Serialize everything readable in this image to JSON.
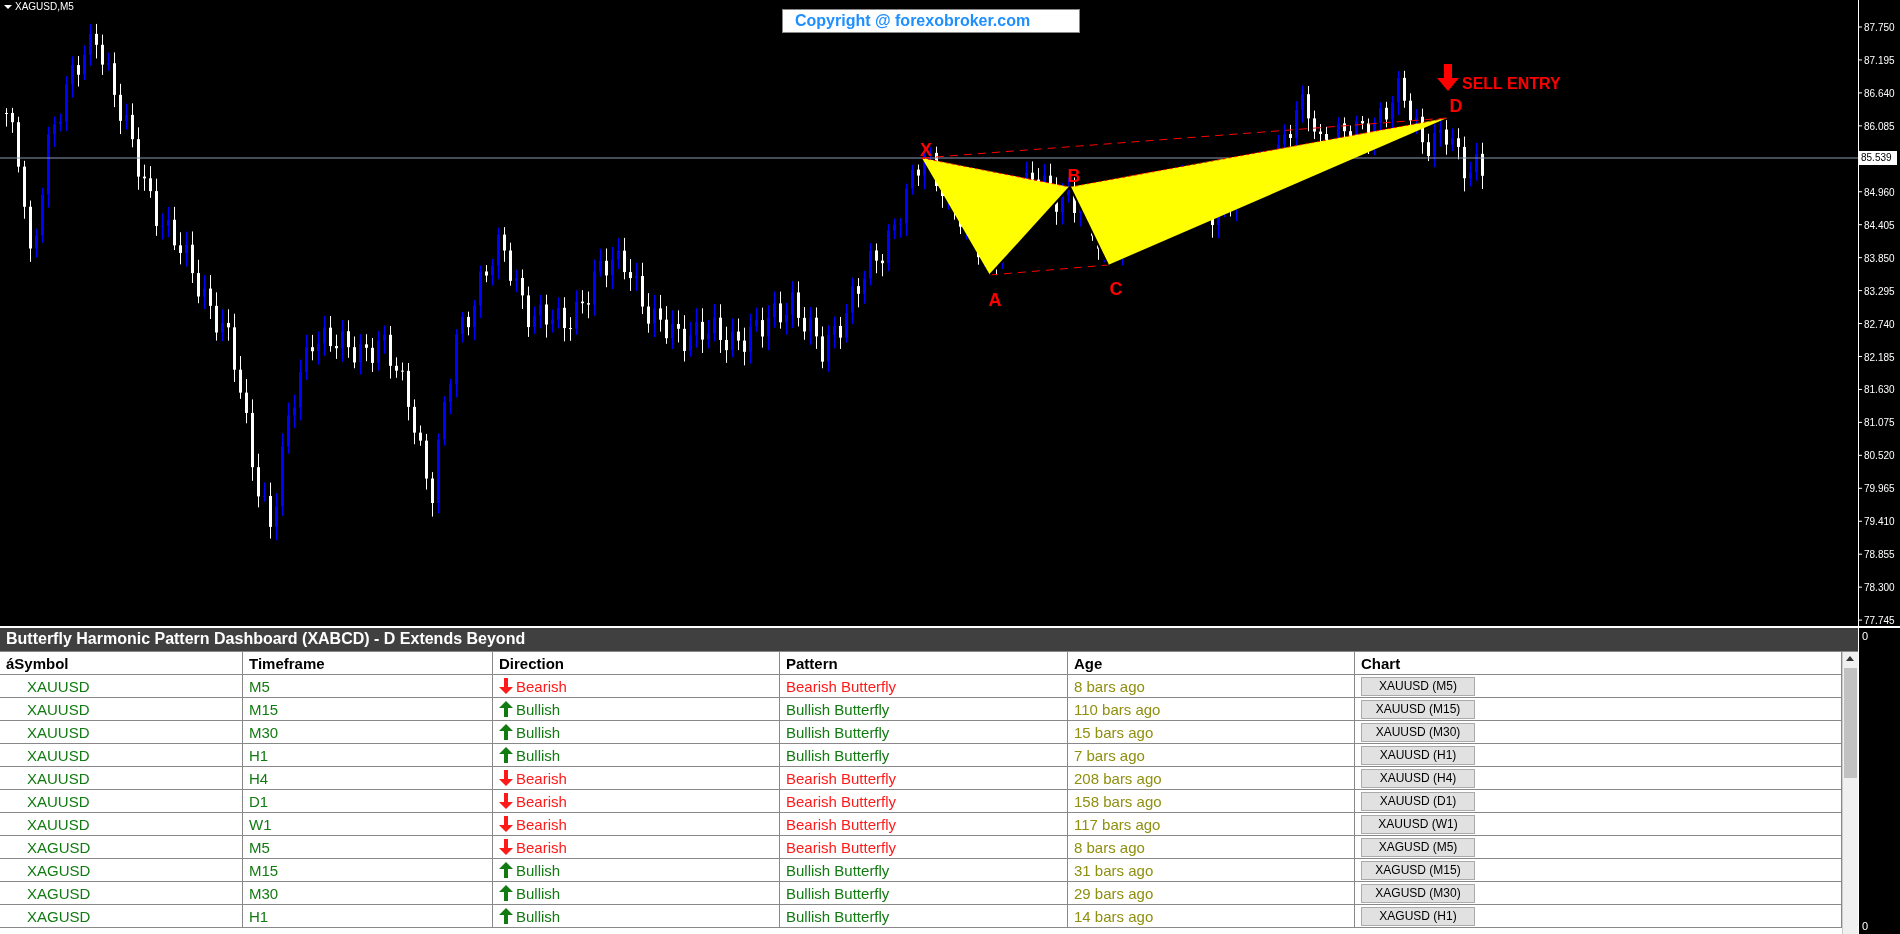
{
  "chart": {
    "symbol_label": "XAGUSD,M5",
    "copyright": "Copyright @ forexobroker.com",
    "pattern_points": [
      "X",
      "A",
      "B",
      "C",
      "D"
    ],
    "signal": "SELL ENTRY",
    "price_axis": [
      "87.750",
      "87.195",
      "86.640",
      "86.085",
      "84.960",
      "84.405",
      "83.850",
      "83.295",
      "82.740",
      "82.185",
      "81.630",
      "81.075",
      "80.520",
      "79.965",
      "79.410",
      "78.855",
      "78.300",
      "77.745"
    ],
    "current_price": "85.539"
  },
  "indicator_axis": [
    "0",
    "0"
  ],
  "dashboard": {
    "title": "Butterfly Harmonic Pattern Dashboard (XABCD) - D Extends Beyond",
    "columns": [
      "áSymbol",
      "Timeframe",
      "Direction",
      "Pattern",
      "Age",
      "Chart"
    ],
    "rows": [
      {
        "symbol": "XAUUSD",
        "timeframe": "M5",
        "kind": "bearish",
        "direction": "Bearish",
        "pattern": "Bearish Butterfly",
        "age": "8 bars ago",
        "chart_button": "XAUUSD (M5)"
      },
      {
        "symbol": "XAUUSD",
        "timeframe": "M15",
        "kind": "bullish",
        "direction": "Bullish",
        "pattern": "Bullish Butterfly",
        "age": "110 bars ago",
        "chart_button": "XAUUSD (M15)"
      },
      {
        "symbol": "XAUUSD",
        "timeframe": "M30",
        "kind": "bullish",
        "direction": "Bullish",
        "pattern": "Bullish Butterfly",
        "age": "15 bars ago",
        "chart_button": "XAUUSD (M30)"
      },
      {
        "symbol": "XAUUSD",
        "timeframe": "H1",
        "kind": "bullish",
        "direction": "Bullish",
        "pattern": "Bullish Butterfly",
        "age": "7 bars ago",
        "chart_button": "XAUUSD (H1)"
      },
      {
        "symbol": "XAUUSD",
        "timeframe": "H4",
        "kind": "bearish",
        "direction": "Bearish",
        "pattern": "Bearish Butterfly",
        "age": "208 bars ago",
        "chart_button": "XAUUSD (H4)"
      },
      {
        "symbol": "XAUUSD",
        "timeframe": "D1",
        "kind": "bearish",
        "direction": "Bearish",
        "pattern": "Bearish Butterfly",
        "age": "158 bars ago",
        "chart_button": "XAUUSD (D1)"
      },
      {
        "symbol": "XAUUSD",
        "timeframe": "W1",
        "kind": "bearish",
        "direction": "Bearish",
        "pattern": "Bearish Butterfly",
        "age": "117 bars ago",
        "chart_button": "XAUUSD (W1)"
      },
      {
        "symbol": "XAGUSD",
        "timeframe": "M5",
        "kind": "bearish",
        "direction": "Bearish",
        "pattern": "Bearish Butterfly",
        "age": "8 bars ago",
        "chart_button": "XAGUSD (M5)"
      },
      {
        "symbol": "XAGUSD",
        "timeframe": "M15",
        "kind": "bullish",
        "direction": "Bullish",
        "pattern": "Bullish Butterfly",
        "age": "31 bars ago",
        "chart_button": "XAGUSD (M15)"
      },
      {
        "symbol": "XAGUSD",
        "timeframe": "M30",
        "kind": "bullish",
        "direction": "Bullish",
        "pattern": "Bullish Butterfly",
        "age": "29 bars ago",
        "chart_button": "XAGUSD (M30)"
      },
      {
        "symbol": "XAGUSD",
        "timeframe": "H1",
        "kind": "bullish",
        "direction": "Bullish",
        "pattern": "Bullish Butterfly",
        "age": "14 bars ago",
        "chart_button": "XAGUSD (H1)"
      }
    ]
  }
}
